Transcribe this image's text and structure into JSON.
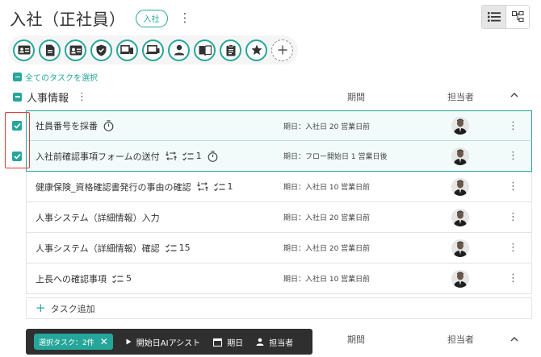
{
  "header": {
    "title": "入社（正社員）",
    "tag": "入社"
  },
  "select_all_label": "全てのタスクを選択",
  "category_icons": [
    "id-card-icon",
    "document-icon",
    "contact-card-icon",
    "shield-icon",
    "devices-icon",
    "laptop-icon",
    "person-icon",
    "book-icon",
    "clipboard-icon",
    "star-icon",
    "add-icon"
  ],
  "group": {
    "name": "人事情報",
    "col_period": "期間",
    "col_assignee": "担当者"
  },
  "tasks": [
    {
      "name": "社員番号を採番",
      "badges": [
        "timer-icon"
      ],
      "count": "",
      "period": "期日：入社日 20 営業日前",
      "selected": true
    },
    {
      "name": "入社前確認事項フォームの送付",
      "badges": [
        "flow-icon",
        "checklist-icon"
      ],
      "count": "1",
      "timer": true,
      "period": "期日：フロー開始日 1 営業日後",
      "selected": true
    },
    {
      "name": "健康保険_資格確認書発行の事由の確認",
      "badges": [
        "flow-icon",
        "checklist-icon"
      ],
      "count": "1",
      "period": "期日：入社日 10 営業日前",
      "selected": false
    },
    {
      "name": "人事システム（詳細情報）入力",
      "badges": [],
      "count": "",
      "period": "期日：入社日 20 営業日前",
      "selected": false
    },
    {
      "name": "人事システム（詳細情報）確認",
      "badges": [
        "checklist-icon"
      ],
      "count": "15",
      "period": "期日：入社日 20 営業日前",
      "selected": false
    },
    {
      "name": "上長への確認事項",
      "badges": [
        "checklist-icon"
      ],
      "count": "5",
      "period": "期日：入社日 10 営業日前",
      "selected": false
    }
  ],
  "add_task_label": "タスク追加",
  "bottom_bar": {
    "selected_label": "選択タスク：2件",
    "ai_label": "開始日AIアシスト",
    "due_label": "期日",
    "assignee_label": "担当者"
  },
  "colors": {
    "accent": "#26a69a",
    "highlight": "#e53935",
    "bar_bg": "#2f2f2f"
  }
}
